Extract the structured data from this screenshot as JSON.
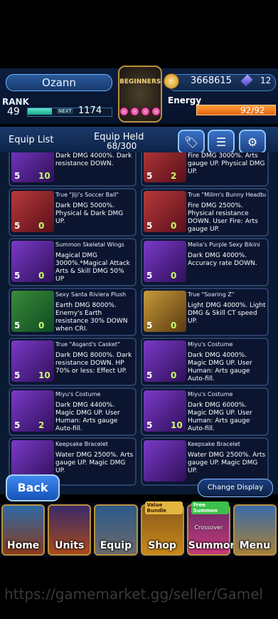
{
  "header": {
    "player_name": "Ozann",
    "rank_label": "RANK",
    "rank_value": "49",
    "next_label": "NEXT",
    "next_value": "1174",
    "gold": "3668615",
    "gems": "12",
    "energy_label": "Energy",
    "energy_value": "92/92",
    "emblem_text": "BEGINNERS"
  },
  "equip_bar": {
    "list_label": "Equip List",
    "held_label": "Equip Held",
    "held_value": "68/300",
    "icons": [
      "tag-icon",
      "sort-icon",
      "gear-icon"
    ]
  },
  "cards": [
    {
      "name": "",
      "desc": "Dark DMG 4000%. Dark resistance DOWN.",
      "level": "5",
      "plus": "10",
      "color": "purple"
    },
    {
      "name": "",
      "desc": "Fire DMG 3000%. Arts gauge UP. Physical DMG UP.",
      "level": "5",
      "plus": "2",
      "color": "red"
    },
    {
      "name": "True \"Jiji's Soccer Ball\"",
      "desc": "Dark DMG 5000%. Physical & Dark DMG UP.",
      "level": "5",
      "plus": "0",
      "color": "red"
    },
    {
      "name": "True \"Milim's Bunny Headband\"",
      "desc": "Fire DMG 2500%. Physical resistance DOWN. User Fire: Arts gauge UP.",
      "level": "5",
      "plus": "0",
      "color": "red"
    },
    {
      "name": "Summon Skeletal Wings",
      "desc": "Magical DMG 3000%.*Magical Attack Arts & Skill DMG 50% UP",
      "level": "5",
      "plus": "0",
      "color": "purple"
    },
    {
      "name": "Melia's Purple Sexy Bikini",
      "desc": "Dark DMG 4000%. Accuracy rate DOWN.",
      "level": "5",
      "plus": "0",
      "color": "purple"
    },
    {
      "name": "Sexy Santa Riviera Plush",
      "desc": "Earth DMG 8000%. Enemy's Earth resistance 30% DOWN when CRI.",
      "level": "5",
      "plus": "0",
      "color": "green"
    },
    {
      "name": "True \"Soaring Z\"",
      "desc": "Light DMG 4000%. Light DMG & Skill CT speed UP.",
      "level": "5",
      "plus": "0",
      "color": "gold"
    },
    {
      "name": "True \"Asgard's Casket\"",
      "desc": "Dark DMG 8000%. Dark resistance DOWN. HP 70% or less: Effect UP.",
      "level": "5",
      "plus": "10",
      "color": "purple"
    },
    {
      "name": "Miyu's Costume",
      "desc": "Dark DMG 4000%. Magic DMG UP. User Human: Arts gauge Auto-fill.",
      "level": "5",
      "plus": "0",
      "color": "purple"
    },
    {
      "name": "Miyu's Costume",
      "desc": "Dark DMG 4400%. Magic DMG UP. User Human: Arts gauge Auto-fill.",
      "level": "5",
      "plus": "2",
      "color": "purple"
    },
    {
      "name": "Miyu's Costume",
      "desc": "Dark DMG 6000%. Magic DMG UP. User Human: Arts gauge Auto-fill.",
      "level": "5",
      "plus": "10",
      "color": "purple"
    },
    {
      "name": "Keepsake Bracelet",
      "desc": "Water DMG 2500%. Arts gauge UP. Magic DMG UP.",
      "level": "",
      "plus": "",
      "color": "purple"
    },
    {
      "name": "Keepsake Bracelet",
      "desc": "Water DMG 2500%. Arts gauge UP. Magic DMG UP.",
      "level": "",
      "plus": "",
      "color": "purple"
    }
  ],
  "controls": {
    "back_label": "Back",
    "change_display_label": "Change Display"
  },
  "nav": [
    {
      "label": "Home",
      "badge": ""
    },
    {
      "label": "Units",
      "badge": ""
    },
    {
      "label": "Equip",
      "badge": ""
    },
    {
      "label": "Shop",
      "badge": "Value Bundle"
    },
    {
      "label": "Summon",
      "badge": "Free Summon",
      "sub": "Crossover"
    },
    {
      "label": "Menu",
      "badge": ""
    }
  ],
  "watermark": "https://gamemarket.gg/seller/Gamel"
}
